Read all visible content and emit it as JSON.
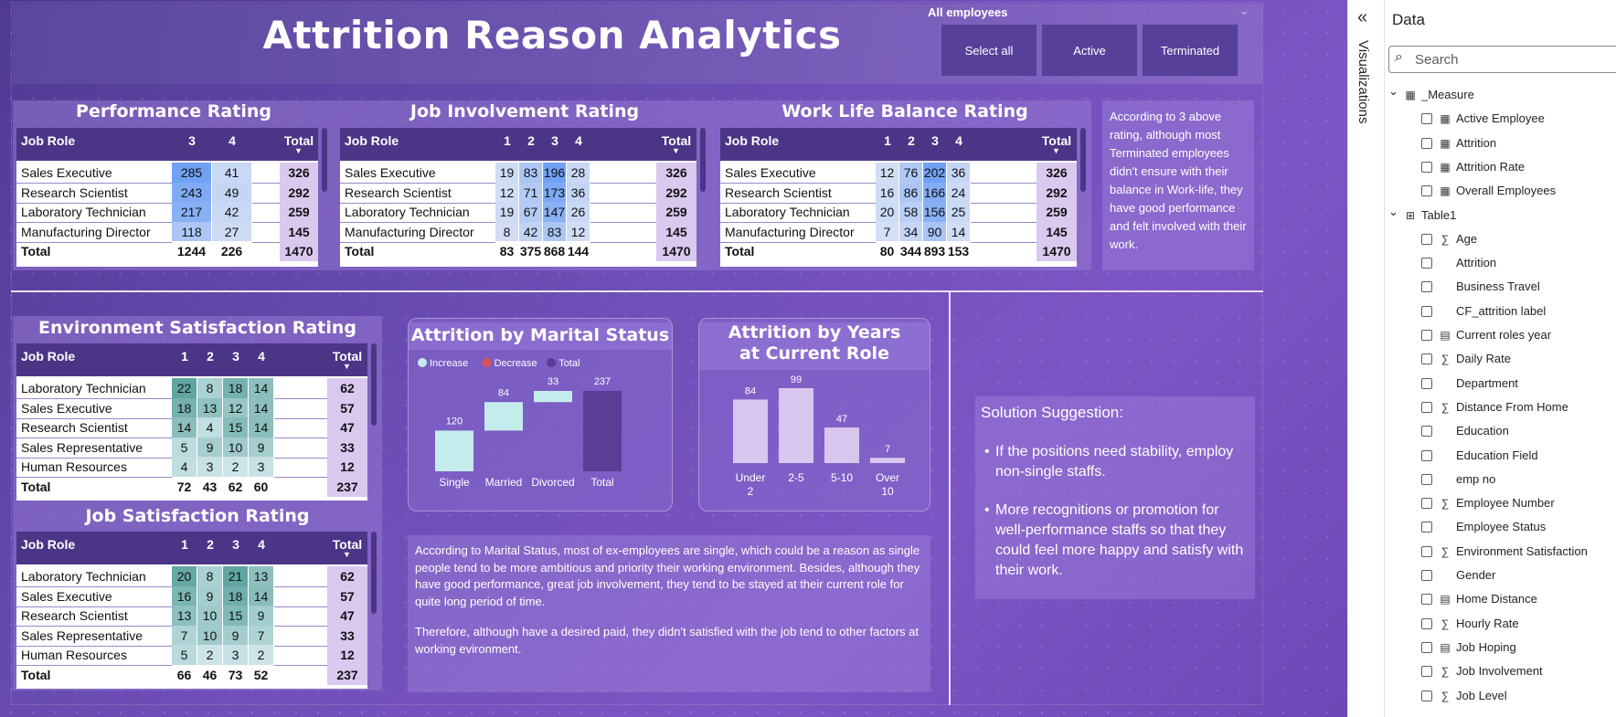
{
  "title": "Attrition Reason Analytics",
  "slicer": {
    "title": "All employees",
    "options": [
      "Select all",
      "Active",
      "Terminated"
    ]
  },
  "perf": {
    "title": "Performance Rating",
    "headers": [
      "Job Role",
      "3",
      "4",
      "Total"
    ],
    "rows": [
      [
        "Sales Executive",
        "285",
        "41",
        "326"
      ],
      [
        "Research Scientist",
        "243",
        "49",
        "292"
      ],
      [
        "Laboratory Technician",
        "217",
        "42",
        "259"
      ],
      [
        "Manufacturing Director",
        "118",
        "27",
        "145"
      ]
    ],
    "total": [
      "Total",
      "1244",
      "226",
      "1470"
    ]
  },
  "jobinv": {
    "title": "Job Involvement Rating",
    "headers": [
      "Job Role",
      "1",
      "2",
      "3",
      "4",
      "Total"
    ],
    "rows": [
      [
        "Sales Executive",
        "19",
        "83",
        "196",
        "28",
        "326"
      ],
      [
        "Research Scientist",
        "12",
        "71",
        "173",
        "36",
        "292"
      ],
      [
        "Laboratory Technician",
        "19",
        "67",
        "147",
        "26",
        "259"
      ],
      [
        "Manufacturing Director",
        "8",
        "42",
        "83",
        "12",
        "145"
      ]
    ],
    "total": [
      "Total",
      "83",
      "375",
      "868",
      "144",
      "1470"
    ]
  },
  "wlb": {
    "title": "Work Life Balance Rating",
    "headers": [
      "Job Role",
      "1",
      "2",
      "3",
      "4",
      "Total"
    ],
    "rows": [
      [
        "Sales Executive",
        "12",
        "76",
        "202",
        "36",
        "326"
      ],
      [
        "Research Scientist",
        "16",
        "86",
        "166",
        "24",
        "292"
      ],
      [
        "Laboratory Technician",
        "20",
        "58",
        "156",
        "25",
        "259"
      ],
      [
        "Manufacturing Director",
        "7",
        "34",
        "90",
        "14",
        "145"
      ]
    ],
    "total": [
      "Total",
      "80",
      "344",
      "893",
      "153",
      "1470"
    ]
  },
  "rating_note": "According to 3 above rating, although most Terminated employees didn't ensure with their balance in Work-life, they have good performance and felt involved with their work.",
  "env": {
    "title": "Environment Satisfaction Rating",
    "headers": [
      "Job Role",
      "1",
      "2",
      "3",
      "4",
      "Total"
    ],
    "rows": [
      [
        "Laboratory Technician",
        "22",
        "8",
        "18",
        "14",
        "62"
      ],
      [
        "Sales Executive",
        "18",
        "13",
        "12",
        "14",
        "57"
      ],
      [
        "Research Scientist",
        "14",
        "4",
        "15",
        "14",
        "47"
      ],
      [
        "Sales Representative",
        "5",
        "9",
        "10",
        "9",
        "33"
      ],
      [
        "Human Resources",
        "4",
        "3",
        "2",
        "3",
        "12"
      ]
    ],
    "total": [
      "Total",
      "72",
      "43",
      "62",
      "60",
      "237"
    ]
  },
  "jobsat": {
    "title": "Job Satisfaction Rating",
    "headers": [
      "Job Role",
      "1",
      "2",
      "3",
      "4",
      "Total"
    ],
    "rows": [
      [
        "Laboratory Technician",
        "20",
        "8",
        "21",
        "13",
        "62"
      ],
      [
        "Sales Executive",
        "16",
        "9",
        "18",
        "14",
        "57"
      ],
      [
        "Research Scientist",
        "13",
        "10",
        "15",
        "9",
        "47"
      ],
      [
        "Sales Representative",
        "7",
        "10",
        "9",
        "7",
        "33"
      ],
      [
        "Human Resources",
        "5",
        "2",
        "3",
        "2",
        "12"
      ]
    ],
    "total": [
      "Total",
      "66",
      "46",
      "73",
      "52",
      "237"
    ]
  },
  "chart_data": [
    {
      "type": "waterfall",
      "title": "Attrition by Marital Status",
      "legend": [
        "Increase",
        "Decrease",
        "Total"
      ],
      "legend_colors": [
        "#c5ecec",
        "#d9535a",
        "#5b3c96"
      ],
      "categories": [
        "Single",
        "Married",
        "Divorced",
        "Total"
      ],
      "values": [
        120,
        84,
        33,
        237
      ],
      "ylim": [
        0,
        237
      ]
    },
    {
      "type": "bar",
      "title": "Attrition by Years at Current Role",
      "categories": [
        "Under 2",
        "2-5",
        "5-10",
        "Over 10"
      ],
      "values": [
        84,
        99,
        47,
        7
      ],
      "ylim": [
        0,
        99
      ]
    }
  ],
  "marital_note": [
    "According to Marital Status, most of ex-employees are single, which could be a reason as single people tend to be more ambitious and priority their working environment. Besides, although they have good performance, great job involvement, they tend to be stayed at their current role for quite long period of time.",
    "Therefore, although have a desired paid, they didn't satisfied with the job tend to other factors at working evironment."
  ],
  "solution": {
    "title": "Solution Suggestion:",
    "items": [
      "If the positions need stability, employ non-single staffs.",
      "More recognitions or promotion for well-performance staffs so that they could feel more happy and satisfy with their work."
    ]
  },
  "viz_label": "Visualizations",
  "data_pane": {
    "title": "Data",
    "search_placeholder": "Search",
    "groups": [
      {
        "name": "_Measure",
        "icon": "table-calc-icon",
        "fields": [
          {
            "name": "Active Employee",
            "icon": "calculator-icon"
          },
          {
            "name": "Attrition",
            "icon": "calculator-icon"
          },
          {
            "name": "Attrition Rate",
            "icon": "calculator-icon"
          },
          {
            "name": "Overall Employees",
            "icon": "calculator-icon"
          }
        ]
      },
      {
        "name": "Table1",
        "icon": "table-icon",
        "fields": [
          {
            "name": "Age",
            "icon": "sigma-icon"
          },
          {
            "name": "Attrition",
            "icon": ""
          },
          {
            "name": "Business Travel",
            "icon": ""
          },
          {
            "name": "CF_attrition label",
            "icon": ""
          },
          {
            "name": "Current roles year",
            "icon": "calc-column-icon"
          },
          {
            "name": "Daily Rate",
            "icon": "sigma-icon"
          },
          {
            "name": "Department",
            "icon": ""
          },
          {
            "name": "Distance From Home",
            "icon": "sigma-icon"
          },
          {
            "name": "Education",
            "icon": ""
          },
          {
            "name": "Education Field",
            "icon": ""
          },
          {
            "name": "emp no",
            "icon": ""
          },
          {
            "name": "Employee Number",
            "icon": "sigma-icon"
          },
          {
            "name": "Employee Status",
            "icon": ""
          },
          {
            "name": "Environment Satisfaction",
            "icon": "sigma-icon"
          },
          {
            "name": "Gender",
            "icon": ""
          },
          {
            "name": "Home Distance",
            "icon": "calc-column-icon"
          },
          {
            "name": "Hourly Rate",
            "icon": "sigma-icon"
          },
          {
            "name": "Job Hoping",
            "icon": "calc-column-icon"
          },
          {
            "name": "Job Involvement",
            "icon": "sigma-icon"
          },
          {
            "name": "Job Level",
            "icon": "sigma-icon"
          }
        ]
      }
    ]
  }
}
